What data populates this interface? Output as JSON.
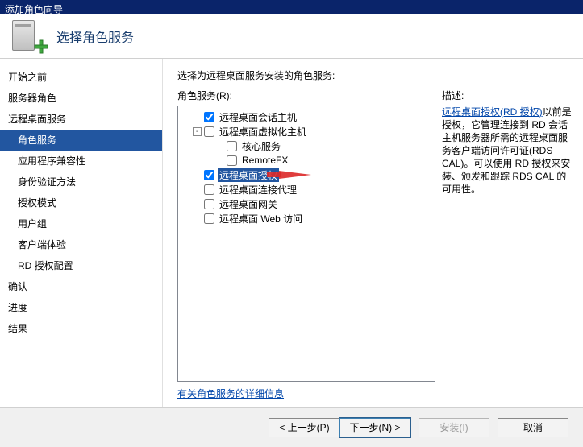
{
  "window": {
    "title": "添加角色向导"
  },
  "header": {
    "title": "选择角色服务"
  },
  "sidebar": {
    "items": [
      {
        "label": "开始之前",
        "indent": 0
      },
      {
        "label": "服务器角色",
        "indent": 0
      },
      {
        "label": "远程桌面服务",
        "indent": 0
      },
      {
        "label": "角色服务",
        "indent": 1,
        "selected": true
      },
      {
        "label": "应用程序兼容性",
        "indent": 1
      },
      {
        "label": "身份验证方法",
        "indent": 1
      },
      {
        "label": "授权模式",
        "indent": 1
      },
      {
        "label": "用户组",
        "indent": 1
      },
      {
        "label": "客户端体验",
        "indent": 1
      },
      {
        "label": "RD 授权配置",
        "indent": 1
      },
      {
        "label": "确认",
        "indent": 0
      },
      {
        "label": "进度",
        "indent": 0
      },
      {
        "label": "结果",
        "indent": 0
      }
    ]
  },
  "content": {
    "prompt": "选择为远程桌面服务安装的角色服务:",
    "roles_label": "角色服务(R):",
    "desc_label": "描述:",
    "tree": [
      {
        "label": "远程桌面会话主机",
        "depth": 0,
        "checked": true,
        "expander": ""
      },
      {
        "label": "远程桌面虚拟化主机",
        "depth": 0,
        "checked": false,
        "expander": "-"
      },
      {
        "label": "核心服务",
        "depth": 1,
        "checked": false,
        "expander": ""
      },
      {
        "label": "RemoteFX",
        "depth": 1,
        "checked": false,
        "expander": ""
      },
      {
        "label": "远程桌面授权",
        "depth": 0,
        "checked": true,
        "expander": "",
        "selected": true
      },
      {
        "label": "远程桌面连接代理",
        "depth": 0,
        "checked": false,
        "expander": ""
      },
      {
        "label": "远程桌面网关",
        "depth": 0,
        "checked": false,
        "expander": ""
      },
      {
        "label": "远程桌面 Web 访问",
        "depth": 0,
        "checked": false,
        "expander": ""
      }
    ],
    "more_link": "有关角色服务的详细信息",
    "description": {
      "link_text": "远程桌面授权(RD 授权)",
      "body": "以前是授权，它管理连接到 RD 会话主机服务器所需的远程桌面服务客户端访问许可证(RDS CAL)。可以使用 RD 授权来安装、颁发和跟踪 RDS CAL 的可用性。"
    }
  },
  "footer": {
    "prev": "< 上一步(P)",
    "next": "下一步(N) >",
    "install": "安装(I)",
    "cancel": "取消"
  }
}
